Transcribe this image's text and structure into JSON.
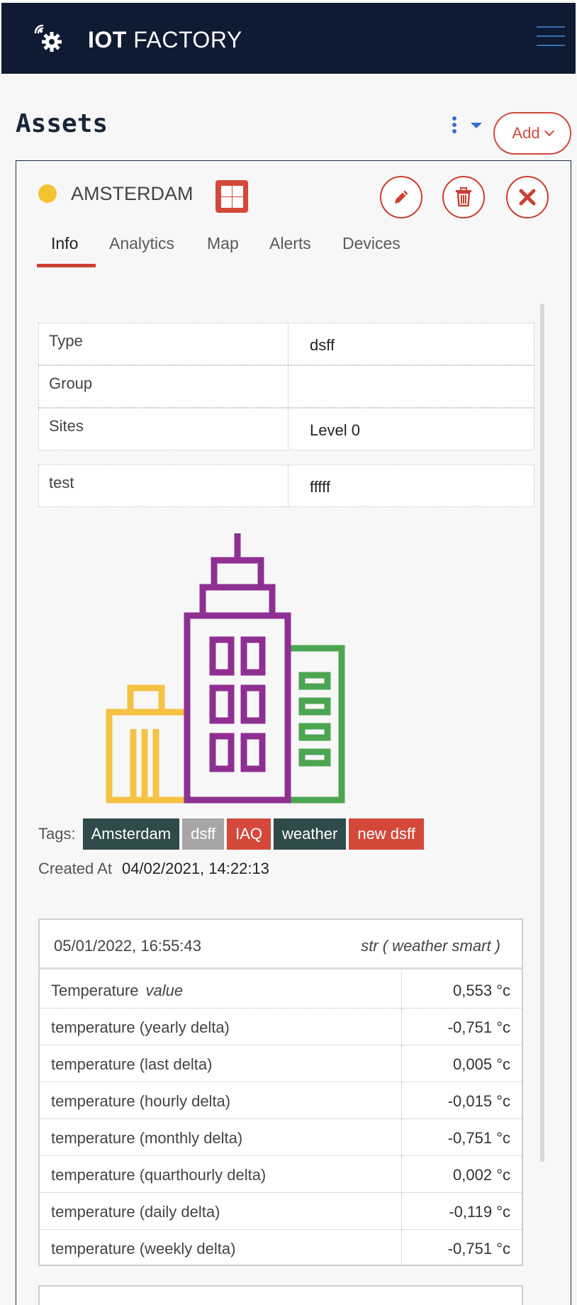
{
  "header": {
    "app_title_bold": "IOT",
    "app_title_rest": " FACTORY",
    "logo_icon": "gear-signal-icon",
    "menu_icon": "hamburger-icon"
  },
  "page": {
    "title": "Assets",
    "add_label": "Add"
  },
  "asset": {
    "name": "AMSTERDAM",
    "status_color": "#f0c531",
    "tabs": [
      "Info",
      "Analytics",
      "Map",
      "Alerts",
      "Devices"
    ],
    "active_tab": "Info",
    "info": [
      {
        "key": "Type",
        "value": "dsff"
      },
      {
        "key": "Group",
        "value": ""
      },
      {
        "key": "Sites",
        "value": "Level 0"
      },
      {
        "key": "test",
        "value": "fffff"
      }
    ],
    "tags_label": "Tags:",
    "tags": [
      {
        "label": "Amsterdam",
        "color": "#2f4a4a"
      },
      {
        "label": "dsff",
        "color": "#a6a6a6"
      },
      {
        "label": "IAQ",
        "color": "#d4483a"
      },
      {
        "label": "weather",
        "color": "#2f4a4a"
      },
      {
        "label": "new dsff",
        "color": "#d4483a"
      }
    ],
    "created_label": "Created At",
    "created_value": "04/02/2021, 14:22:13"
  },
  "reading": {
    "date": "05/01/2022, 16:55:43",
    "source": "str ( weather smart )",
    "rows": [
      {
        "name": "Temperature",
        "suffix": "value",
        "value": "0,553 °c"
      },
      {
        "name": "temperature (yearly delta)",
        "suffix": "",
        "value": "-0,751 °c"
      },
      {
        "name": "temperature (last delta)",
        "suffix": "",
        "value": "0,005 °c"
      },
      {
        "name": "temperature (hourly delta)",
        "suffix": "",
        "value": "-0,015 °c"
      },
      {
        "name": "temperature (monthly delta)",
        "suffix": "",
        "value": "-0,751 °c"
      },
      {
        "name": "temperature (quarthourly delta)",
        "suffix": "",
        "value": "0,002 °c"
      },
      {
        "name": "temperature (daily delta)",
        "suffix": "",
        "value": "-0,119 °c"
      },
      {
        "name": "temperature (weekly delta)",
        "suffix": "",
        "value": "-0,751 °c"
      }
    ]
  },
  "colors": {
    "accent": "#cc3f31",
    "navbar": "#0e1b33",
    "building_yellow": "#f5c244",
    "building_purple": "#8e2f92",
    "building_green": "#4ba551"
  }
}
